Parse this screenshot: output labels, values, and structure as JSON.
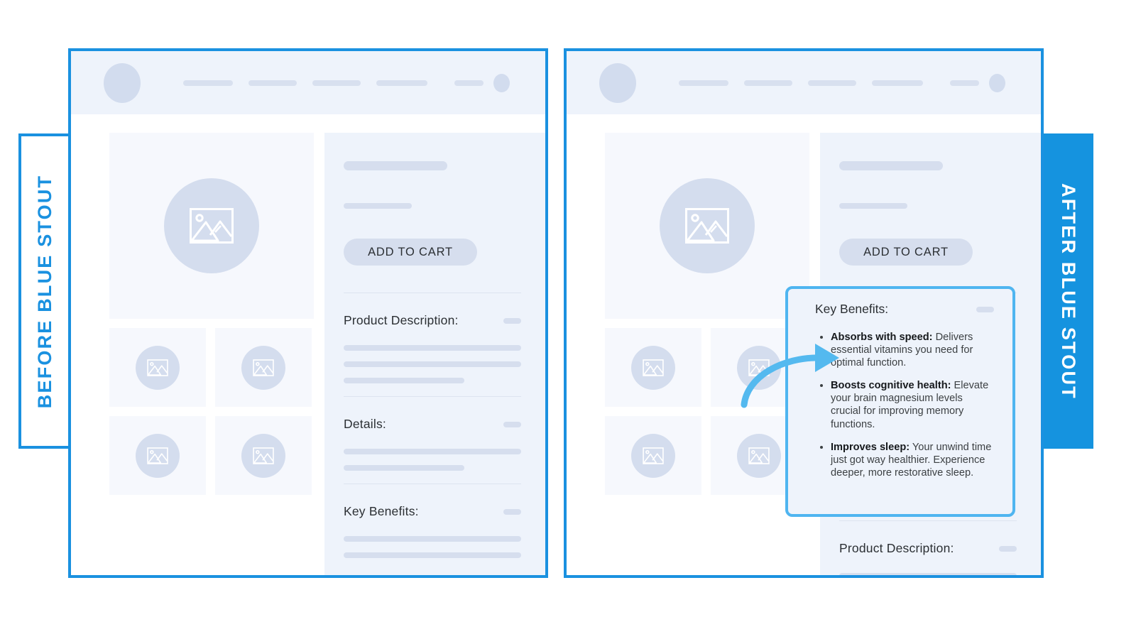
{
  "labels": {
    "before_tab": "BEFORE BLUE STOUT",
    "after_tab": "AFTER BLUE STOUT"
  },
  "colors": {
    "brand_blue": "#1593df",
    "panel_border_blue": "#1a91e0",
    "callout_border_blue": "#4fb5f0",
    "arrow_blue": "#54b9ef",
    "panel_bg": "#eef3fb",
    "placeholder_gray": "#d6deee",
    "tile_bg": "#f6f8fd"
  },
  "browser": {
    "logo": "logo-placeholder",
    "nav_items": [
      "nav-link-1",
      "nav-link-2",
      "nav-link-3",
      "nav-link-4"
    ],
    "nav_right_items": [
      "nav-link-5",
      "account-avatar"
    ]
  },
  "gallery": {
    "hero_alt": "image-placeholder",
    "thumbnails": [
      "image-placeholder",
      "image-placeholder",
      "image-placeholder",
      "image-placeholder"
    ]
  },
  "before_panel": {
    "cta_label": "ADD TO CART",
    "sections": [
      {
        "title": "Product Description:",
        "lines": [
          "full",
          "full",
          "short"
        ]
      },
      {
        "title": "Details:",
        "lines": [
          "full",
          "short"
        ]
      },
      {
        "title": "Key Benefits:",
        "lines": [
          "full",
          "full"
        ]
      }
    ]
  },
  "after_panel": {
    "cta_label": "ADD TO CART",
    "callout": {
      "title": "Key Benefits:",
      "benefits": [
        {
          "label": "Absorbs with speed:",
          "text": " Delivers essential vitamins you need for optimal function."
        },
        {
          "label": "Boosts cognitive health:",
          "text": " Elevate your brain magnesium levels crucial for improving memory functions."
        },
        {
          "label": "Improves sleep:",
          "text": " Your unwind time just got way healthier. Experience deeper, more restorative sleep."
        }
      ]
    },
    "sections": [
      {
        "title": "Product Description:",
        "lines": [
          "full",
          "full"
        ]
      }
    ]
  }
}
